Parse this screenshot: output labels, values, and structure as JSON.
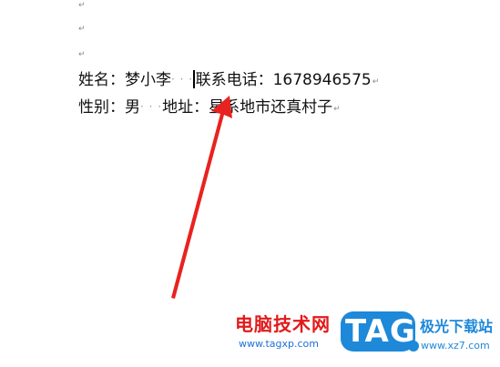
{
  "document": {
    "paragraph_mark": "↵",
    "space_dots": "· · ·",
    "line1": {
      "name_label": "姓名：梦小李",
      "phone_label": "联系电话：",
      "phone_value": "1678946575"
    },
    "line2": {
      "gender_label": "性别：男",
      "address_label": "地址：",
      "address_value": "星系地市还真村子"
    }
  },
  "annotation": {
    "arrow_color": "#e8231f"
  },
  "watermark": {
    "cn_text": "电脑技术网",
    "url": "www.tagxp.com",
    "badge_text": "TAG",
    "site_text": "极光下载站",
    "site_url": "www.xz7.com",
    "badge_color": "#1e88d9"
  }
}
